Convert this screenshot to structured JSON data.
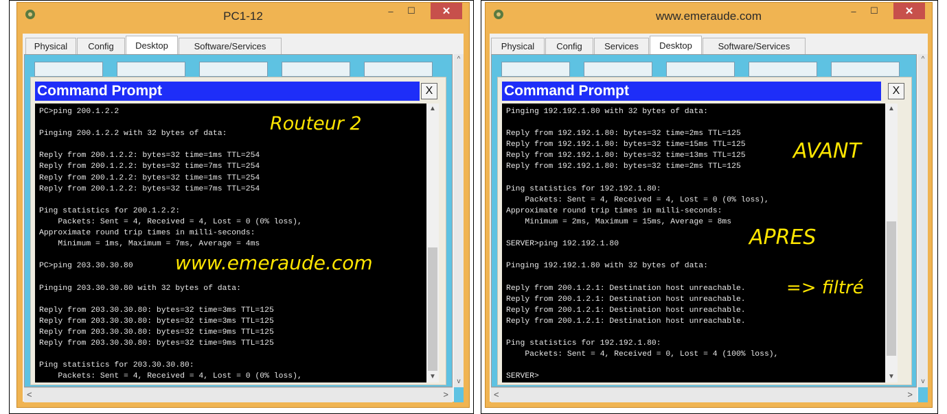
{
  "left": {
    "window_title": "PC1-12",
    "tabs": [
      "Physical",
      "Config",
      "Desktop",
      "Software/Services"
    ],
    "active_tab": "Desktop",
    "dialog_title": "Command Prompt",
    "close_glyph": "X",
    "terminal": "PC>ping 200.1.2.2\n\nPinging 200.1.2.2 with 32 bytes of data:\n\nReply from 200.1.2.2: bytes=32 time=1ms TTL=254\nReply from 200.1.2.2: bytes=32 time=7ms TTL=254\nReply from 200.1.2.2: bytes=32 time=1ms TTL=254\nReply from 200.1.2.2: bytes=32 time=7ms TTL=254\n\nPing statistics for 200.1.2.2:\n    Packets: Sent = 4, Received = 4, Lost = 0 (0% loss),\nApproximate round trip times in milli-seconds:\n    Minimum = 1ms, Maximum = 7ms, Average = 4ms\n\nPC>ping 203.30.30.80\n\nPinging 203.30.30.80 with 32 bytes of data:\n\nReply from 203.30.30.80: bytes=32 time=3ms TTL=125\nReply from 203.30.30.80: bytes=32 time=3ms TTL=125\nReply from 203.30.30.80: bytes=32 time=9ms TTL=125\nReply from 203.30.30.80: bytes=32 time=9ms TTL=125\n\nPing statistics for 203.30.30.80:\n    Packets: Sent = 4, Received = 4, Lost = 0 (0% loss),",
    "annotations": {
      "routeur": "Routeur 2",
      "site": "www.emeraude.com"
    }
  },
  "right": {
    "window_title": "www.emeraude.com",
    "tabs": [
      "Physical",
      "Config",
      "Services",
      "Desktop",
      "Software/Services"
    ],
    "active_tab": "Desktop",
    "dialog_title": "Command Prompt",
    "close_glyph": "X",
    "terminal": "Pinging 192.192.1.80 with 32 bytes of data:\n\nReply from 192.192.1.80: bytes=32 time=2ms TTL=125\nReply from 192.192.1.80: bytes=32 time=15ms TTL=125\nReply from 192.192.1.80: bytes=32 time=13ms TTL=125\nReply from 192.192.1.80: bytes=32 time=2ms TTL=125\n\nPing statistics for 192.192.1.80:\n    Packets: Sent = 4, Received = 4, Lost = 0 (0% loss),\nApproximate round trip times in milli-seconds:\n    Minimum = 2ms, Maximum = 15ms, Average = 8ms\n\nSERVER>ping 192.192.1.80\n\nPinging 192.192.1.80 with 32 bytes of data:\n\nReply from 200.1.2.1: Destination host unreachable.\nReply from 200.1.2.1: Destination host unreachable.\nReply from 200.1.2.1: Destination host unreachable.\nReply from 200.1.2.1: Destination host unreachable.\n\nPing statistics for 192.192.1.80:\n    Packets: Sent = 4, Received = 0, Lost = 4 (100% loss),\n\nSERVER>",
    "annotations": {
      "avant": "AVANT",
      "apres": "APRES",
      "filtre": "=> filtré"
    }
  },
  "colors": {
    "frame": "#f0b452",
    "desktop": "#5ec2e2",
    "dialog_title": "#1e2ef8",
    "annotation": "#ffe600"
  }
}
